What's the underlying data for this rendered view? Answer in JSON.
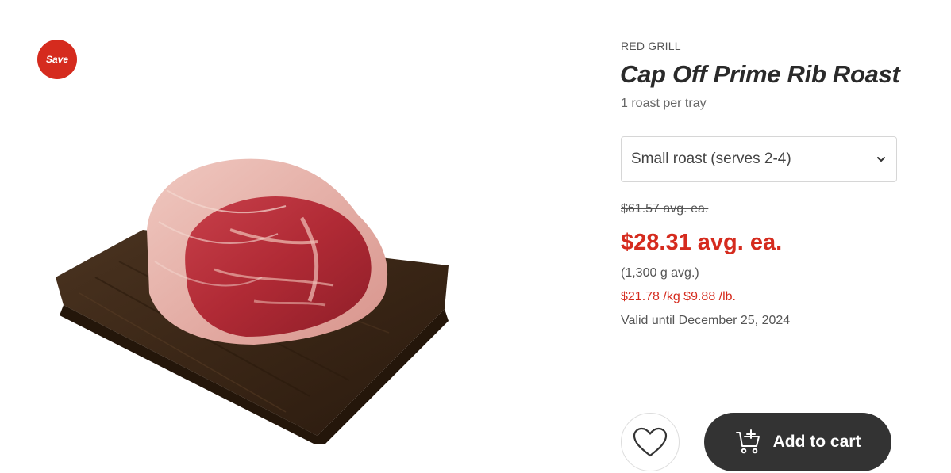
{
  "badge": {
    "label": "Save",
    "color": "#d52b1e"
  },
  "product": {
    "brand": "RED GRILL",
    "title": "Cap Off Prime Rib Roast",
    "subtitle": "1 roast per tray",
    "image_icon": "prime-rib-roast-on-board"
  },
  "variant": {
    "selected": "Small roast (serves 2-4)",
    "icon": "chevron-down-icon"
  },
  "pricing": {
    "old_price": "$61.57  avg. ea.",
    "sale_price": "$28.31 avg. ea.",
    "weight": "(1,300 g avg.)",
    "unit_price": "$21.78 /kg $9.88 /lb.",
    "valid": "Valid until December 25, 2024",
    "sale_color": "#d52b1e"
  },
  "actions": {
    "favorite_icon": "heart-icon",
    "cart_icon": "cart-add-icon",
    "add_to_cart_label": "Add to cart",
    "cart_button_color": "#333333"
  }
}
